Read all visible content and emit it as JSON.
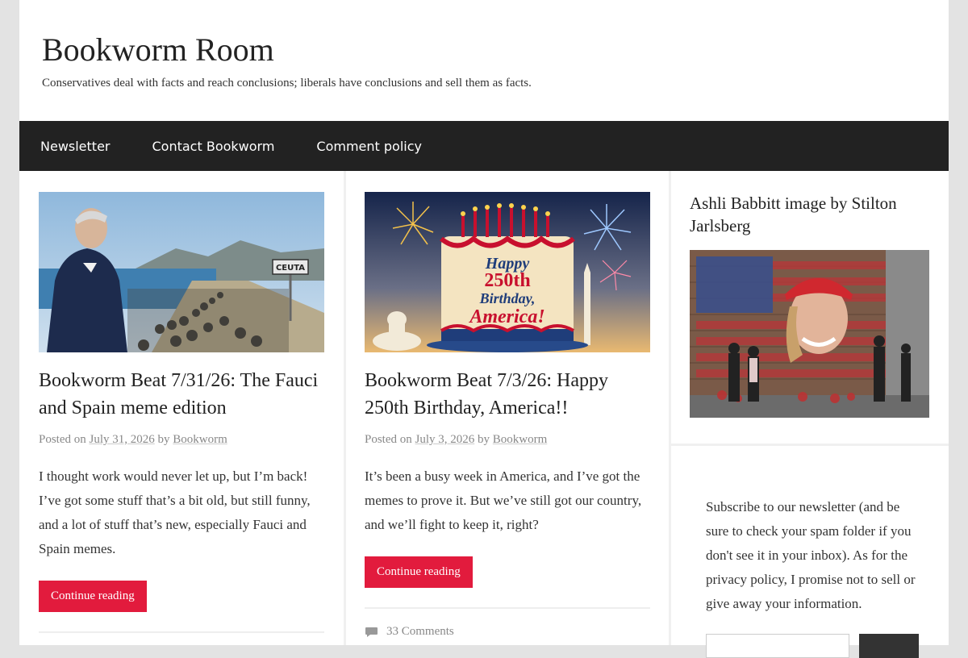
{
  "site": {
    "title": "Bookworm Room",
    "description": "Conservatives deal with facts and reach conclusions; liberals have conclusions and sell them as facts."
  },
  "nav": {
    "items": [
      {
        "label": "Newsletter"
      },
      {
        "label": "Contact Bookworm"
      },
      {
        "label": "Comment policy"
      }
    ]
  },
  "posts": [
    {
      "title": "Bookworm Beat 7/31/26: The Fauci and Spain meme edition",
      "posted_on_label": "Posted on",
      "date": "July 31, 2026",
      "by_label": "by",
      "author": "Bookworm",
      "excerpt": "I thought work would never let up, but I’m back! I’ve got some stuff that’s a bit old, but still funny, and a lot of stuff that’s new, especially Fauci and Spain memes.",
      "read_more": "Continue reading",
      "image_sign": "CEUTA"
    },
    {
      "title": "Bookworm Beat 7/3/26: Happy 250th Birthday, America!!",
      "posted_on_label": "Posted on",
      "date": "July 3, 2026",
      "by_label": "by",
      "author": "Bookworm",
      "excerpt": "It’s been a busy week in America, and I’ve got the memes to prove it. But we’ve still got our country, and we’ll fight to keep it, right?",
      "read_more": "Continue reading",
      "comments": "33 Comments",
      "image_text": {
        "line1": "Happy",
        "line2": "250th",
        "line3": "Birthday,",
        "line4": "America!"
      }
    }
  ],
  "sidebar": {
    "widget_title": "Ashli Babbitt image by Stilton Jarlsberg",
    "newsletter_text": "Subscribe to our newsletter (and be sure to check your spam folder if you don't see it in your inbox). As for the privacy policy, I promise not to sell or give away your information."
  },
  "colors": {
    "accent": "#e21b3d",
    "nav_bg": "#222222"
  }
}
